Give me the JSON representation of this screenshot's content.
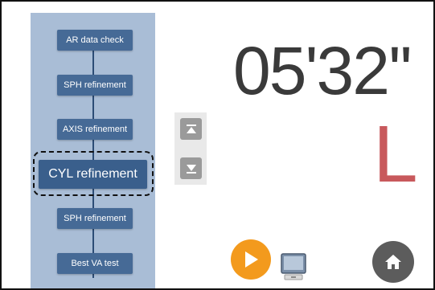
{
  "steps": {
    "items": [
      {
        "label": "AR data check"
      },
      {
        "label": "SPH refinement"
      },
      {
        "label": "AXIS refinement"
      },
      {
        "label": "CYL refinement",
        "active": true
      },
      {
        "label": "SPH refinement"
      },
      {
        "label": "Best VA test"
      }
    ]
  },
  "timer": {
    "value": "05'32''"
  },
  "eye": {
    "letter": "L",
    "color": "#c8595c"
  },
  "controls": {
    "scroll_up_icon": "scroll-to-top-icon",
    "scroll_down_icon": "scroll-to-bottom-icon",
    "play_icon": "play-icon",
    "monitor_icon": "monitor-icon",
    "home_icon": "home-icon"
  },
  "colors": {
    "panel": "#a9bdd6",
    "step": "#466a96",
    "active_step": "#3a5f8c",
    "play": "#f39a1d",
    "home": "#5c5c5c"
  }
}
